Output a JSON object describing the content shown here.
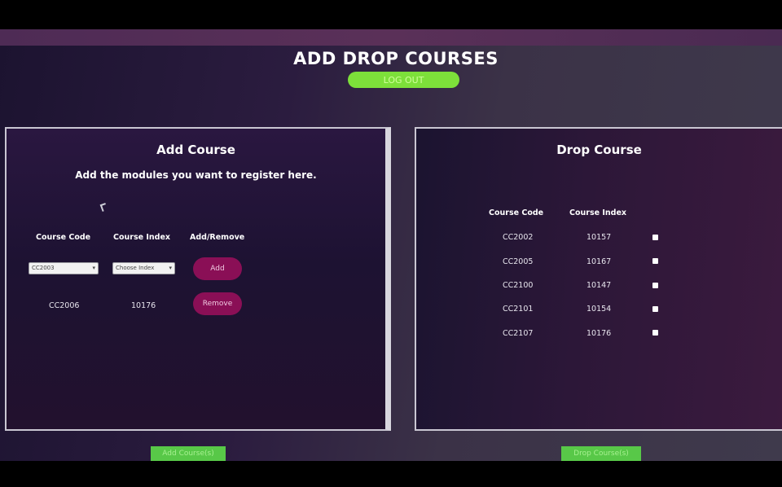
{
  "page": {
    "title": "ADD DROP COURSES",
    "top_button_label": "LOG OUT"
  },
  "add_panel": {
    "title": "Add Course",
    "subtitle": "Add the modules you want to register here.",
    "headers": [
      "Course Code",
      "Course Index",
      "Add/Remove"
    ],
    "course_select_value": "CC2003",
    "index_select_placeholder": "Choose Index",
    "add_button_label": "Add",
    "added_rows": [
      {
        "code": "CC2006",
        "index": "10176",
        "button_label": "Remove"
      }
    ],
    "confirm_button_label": "Add Course(s)"
  },
  "drop_panel": {
    "title": "Drop Course",
    "headers": [
      "Course Code",
      "Course Index"
    ],
    "rows": [
      {
        "code": "CC2002",
        "index": "10157"
      },
      {
        "code": "CC2005",
        "index": "10167"
      },
      {
        "code": "CC2100",
        "index": "10147"
      },
      {
        "code": "CC2101",
        "index": "10154"
      },
      {
        "code": "CC2107",
        "index": "10176"
      }
    ],
    "confirm_button_label": "Drop Course(s)"
  },
  "colors": {
    "accent_green": "#7de03a",
    "magenta_button": "#8a0f56",
    "panel_border": "#c9c6d2"
  }
}
